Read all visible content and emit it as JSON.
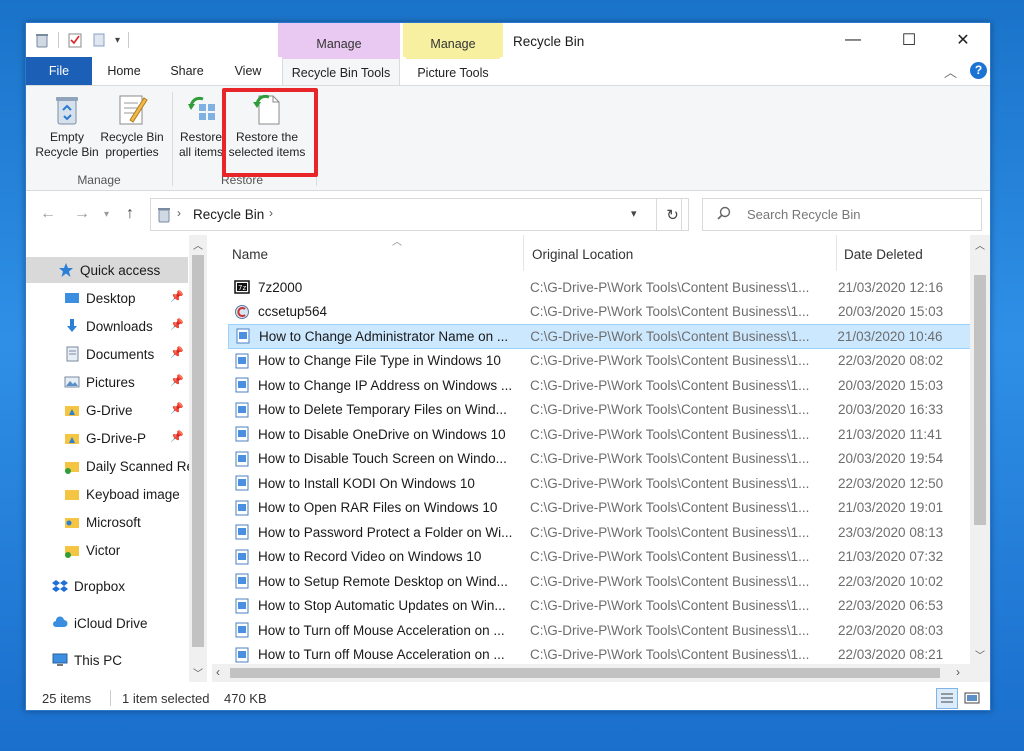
{
  "window": {
    "title": "Recycle Bin",
    "context_tabs": {
      "purple": "Manage",
      "yellow": "Manage"
    },
    "controls": {
      "minimize": "—",
      "maximize": "☐",
      "close": "✕"
    }
  },
  "tabs": [
    "File",
    "Home",
    "Share",
    "View",
    "Recycle Bin Tools",
    "Picture Tools"
  ],
  "ribbon": {
    "empty_l1": "Empty",
    "empty_l2": "Recycle Bin",
    "props_l1": "Recycle Bin",
    "props_l2": "properties",
    "restore_all_l1": "Restore",
    "restore_all_l2": "all items",
    "restore_sel_l1": "Restore the",
    "restore_sel_l2": "selected items",
    "group_manage": "Manage",
    "group_restore": "Restore"
  },
  "address": {
    "path": "Recycle Bin",
    "search_placeholder": "Search Recycle Bin"
  },
  "nav": [
    "Quick access",
    "Desktop",
    "Downloads",
    "Documents",
    "Pictures",
    "G-Drive",
    "G-Drive-P",
    "Daily Scanned Re",
    "Keyboad image",
    "Microsoft",
    "Victor",
    "Dropbox",
    "iCloud Drive",
    "This PC"
  ],
  "columns": {
    "name": "Name",
    "location": "Original Location",
    "date": "Date Deleted"
  },
  "files": [
    {
      "name": "7z2000",
      "loc": "C:\\G-Drive-P\\Work Tools\\Content Business\\1...",
      "date": "21/03/2020 12:16"
    },
    {
      "name": "ccsetup564",
      "loc": "C:\\G-Drive-P\\Work Tools\\Content Business\\1...",
      "date": "20/03/2020 15:03"
    },
    {
      "name": "How to Change Administrator Name on ...",
      "loc": "C:\\G-Drive-P\\Work Tools\\Content Business\\1...",
      "date": "21/03/2020 10:46"
    },
    {
      "name": "How to Change File Type in Windows 10",
      "loc": "C:\\G-Drive-P\\Work Tools\\Content Business\\1...",
      "date": "22/03/2020 08:02"
    },
    {
      "name": "How to Change IP Address on Windows ...",
      "loc": "C:\\G-Drive-P\\Work Tools\\Content Business\\1...",
      "date": "20/03/2020 15:03"
    },
    {
      "name": "How to Delete Temporary Files on Wind...",
      "loc": "C:\\G-Drive-P\\Work Tools\\Content Business\\1...",
      "date": "20/03/2020 16:33"
    },
    {
      "name": "How to Disable OneDrive on Windows 10",
      "loc": "C:\\G-Drive-P\\Work Tools\\Content Business\\1...",
      "date": "21/03/2020 11:41"
    },
    {
      "name": "How to Disable Touch Screen on Windo...",
      "loc": "C:\\G-Drive-P\\Work Tools\\Content Business\\1...",
      "date": "20/03/2020 19:54"
    },
    {
      "name": "How to Install KODI On Windows 10",
      "loc": "C:\\G-Drive-P\\Work Tools\\Content Business\\1...",
      "date": "22/03/2020 12:50"
    },
    {
      "name": "How to Open RAR Files on Windows 10",
      "loc": "C:\\G-Drive-P\\Work Tools\\Content Business\\1...",
      "date": "21/03/2020 19:01"
    },
    {
      "name": "How to Password Protect a Folder on Wi...",
      "loc": "C:\\G-Drive-P\\Work Tools\\Content Business\\1...",
      "date": "23/03/2020 08:13"
    },
    {
      "name": "How to Record Video on Windows 10",
      "loc": "C:\\G-Drive-P\\Work Tools\\Content Business\\1...",
      "date": "21/03/2020 07:32"
    },
    {
      "name": "How to Setup Remote Desktop on Wind...",
      "loc": "C:\\G-Drive-P\\Work Tools\\Content Business\\1...",
      "date": "22/03/2020 10:02"
    },
    {
      "name": "How to Stop Automatic Updates on Win...",
      "loc": "C:\\G-Drive-P\\Work Tools\\Content Business\\1...",
      "date": "22/03/2020 06:53"
    },
    {
      "name": "How to Turn off Mouse Acceleration on ...",
      "loc": "C:\\G-Drive-P\\Work Tools\\Content Business\\1...",
      "date": "22/03/2020 08:03"
    },
    {
      "name": "How to Turn off Mouse Acceleration on ...",
      "loc": "C:\\G-Drive-P\\Work Tools\\Content Business\\1...",
      "date": "22/03/2020 08:21"
    }
  ],
  "status": {
    "count": "25 items",
    "selected": "1 item selected",
    "size": "470 KB"
  },
  "colors": {
    "accent": "#1b5fb6",
    "highlight": "#e8262a",
    "selection": "#cce8ff"
  }
}
